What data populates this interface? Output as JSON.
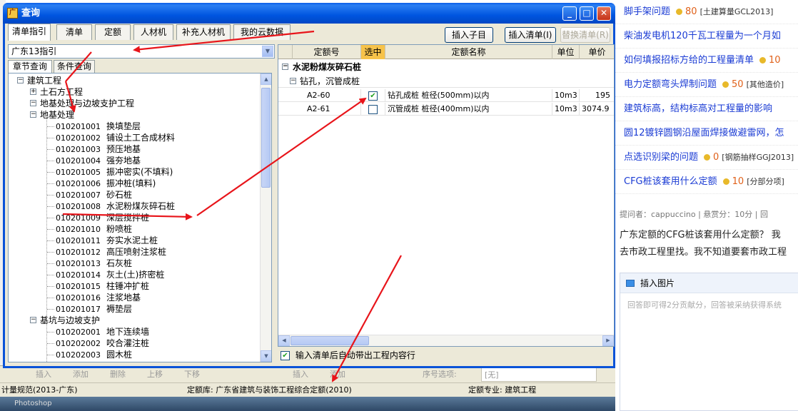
{
  "dialog": {
    "title": "查询",
    "min_label": "_",
    "max_label": "□",
    "close_label": "✕",
    "tabs": [
      "清单指引",
      "清单",
      "定额",
      "人材机",
      "补充人材机",
      "我的云数据"
    ],
    "buttons": {
      "insert_child": "插入子目",
      "insert_list": "插入清单(I)",
      "replace_list": "替换清单(R)"
    },
    "combo_value": "广东13指引",
    "subtabs": [
      "章节查询",
      "条件查询"
    ],
    "tree": [
      {
        "level": 0,
        "pm": "-",
        "code": "",
        "label": "建筑工程"
      },
      {
        "level": 1,
        "pm": "+",
        "code": "",
        "label": "土石方工程"
      },
      {
        "level": 1,
        "pm": "-",
        "code": "",
        "label": "地基处理与边坡支护工程"
      },
      {
        "level": 2,
        "pm": "-",
        "code": "",
        "label": "地基处理"
      },
      {
        "level": 3,
        "pm": "",
        "code": "010201001",
        "label": "换填垫层"
      },
      {
        "level": 3,
        "pm": "",
        "code": "010201002",
        "label": "铺设土工合成材料"
      },
      {
        "level": 3,
        "pm": "",
        "code": "010201003",
        "label": "预压地基"
      },
      {
        "level": 3,
        "pm": "",
        "code": "010201004",
        "label": "强夯地基"
      },
      {
        "level": 3,
        "pm": "",
        "code": "010201005",
        "label": "振冲密实(不填料)"
      },
      {
        "level": 3,
        "pm": "",
        "code": "010201006",
        "label": "振冲桩(填料)"
      },
      {
        "level": 3,
        "pm": "",
        "code": "010201007",
        "label": "砂石桩"
      },
      {
        "level": 3,
        "pm": "",
        "code": "010201008",
        "label": "水泥粉煤灰碎石桩"
      },
      {
        "level": 3,
        "pm": "",
        "code": "010201009",
        "label": "深层搅拌桩"
      },
      {
        "level": 3,
        "pm": "",
        "code": "010201010",
        "label": "粉喷桩"
      },
      {
        "level": 3,
        "pm": "",
        "code": "010201011",
        "label": "夯实水泥土桩"
      },
      {
        "level": 3,
        "pm": "",
        "code": "010201012",
        "label": "高压喷射注浆桩"
      },
      {
        "level": 3,
        "pm": "",
        "code": "010201013",
        "label": "石灰桩"
      },
      {
        "level": 3,
        "pm": "",
        "code": "010201014",
        "label": "灰土(土)挤密桩"
      },
      {
        "level": 3,
        "pm": "",
        "code": "010201015",
        "label": "柱锤冲扩桩"
      },
      {
        "level": 3,
        "pm": "",
        "code": "010201016",
        "label": "注浆地基"
      },
      {
        "level": 3,
        "pm": "",
        "code": "010201017",
        "label": "褥垫层"
      },
      {
        "level": 2,
        "pm": "-",
        "code": "",
        "label": "基坑与边坡支护"
      },
      {
        "level": 3,
        "pm": "",
        "code": "010202001",
        "label": "地下连续墙"
      },
      {
        "level": 3,
        "pm": "",
        "code": "010202002",
        "label": "咬合灌注桩"
      },
      {
        "level": 3,
        "pm": "",
        "code": "010202003",
        "label": "圆木桩"
      }
    ],
    "grid": {
      "headers": [
        "定额号",
        "选中",
        "定额名称",
        "单位",
        "单价"
      ],
      "group": "水泥粉煤灰碎石桩",
      "subgroup": "钻孔，沉管成桩",
      "rows": [
        {
          "code": "A2-60",
          "checked": true,
          "name": "钻孔成桩 桩径(500mm)以内",
          "unit": "10m3",
          "price": "195"
        },
        {
          "code": "A2-61",
          "checked": false,
          "name": "沉管成桩 桩径(400mm)以内",
          "unit": "10m3",
          "price": "3074.9"
        }
      ]
    },
    "autofill_label": "输入清单后自动带出工程内容行"
  },
  "background": {
    "toolbar_left": [
      "插入",
      "添加",
      "删除",
      "上移",
      "下移"
    ],
    "toolbar_right": [
      "插入",
      "添加"
    ],
    "seq_label": "序号选项:",
    "seq_value": "[无]",
    "status": {
      "norm": "计量规范(2013-广东)",
      "quota_lib": "定额库: 广东省建筑与装饰工程综合定额(2010)",
      "major": "定额专业: 建筑工程"
    },
    "desktop": "Photoshop"
  },
  "web": {
    "questions": [
      {
        "title": "脚手架问题",
        "score": "80",
        "tag": "[土建算量GCL2013]"
      },
      {
        "title": "柴油发电机120千瓦工程量为一个月如",
        "score": "",
        "tag": ""
      },
      {
        "title": "如何填报招标方给的工程量清单",
        "score": "10",
        "tag": ""
      },
      {
        "title": "电力定额弯头焊制问题",
        "score": "50",
        "tag": "[其他造价]"
      },
      {
        "title": "建筑标高，结构标高对工程量的影响",
        "score": "",
        "tag": ""
      },
      {
        "title": "圆12镀锌圆钢沿屋面焊接做避雷网，怎",
        "score": "",
        "tag": ""
      },
      {
        "title": "点选识别梁的问题",
        "score": "0",
        "tag": "[钢筋抽样GGJ2013]"
      },
      {
        "title": "CFG桩该套用什么定额",
        "score": "10",
        "tag": "[分部分项]"
      }
    ],
    "meta": "提问者：cappuccino  |  悬赏分：10分  |  回",
    "body_lines": [
      "广东定额的CFG桩该套用什么定额？  我",
      "去市政工程里找。我不知道要套市政工程"
    ],
    "reply_bar": "插入图片",
    "reply_hint": "回答即可得2分贡献分，回答被采纳获得系统"
  },
  "colors": {
    "title_blue": "#0a53d8",
    "link_blue": "#1a3bd4",
    "accent_orange": "#e0611a",
    "arrow_red": "#e8141a",
    "selected_col": "#f7c34a"
  }
}
